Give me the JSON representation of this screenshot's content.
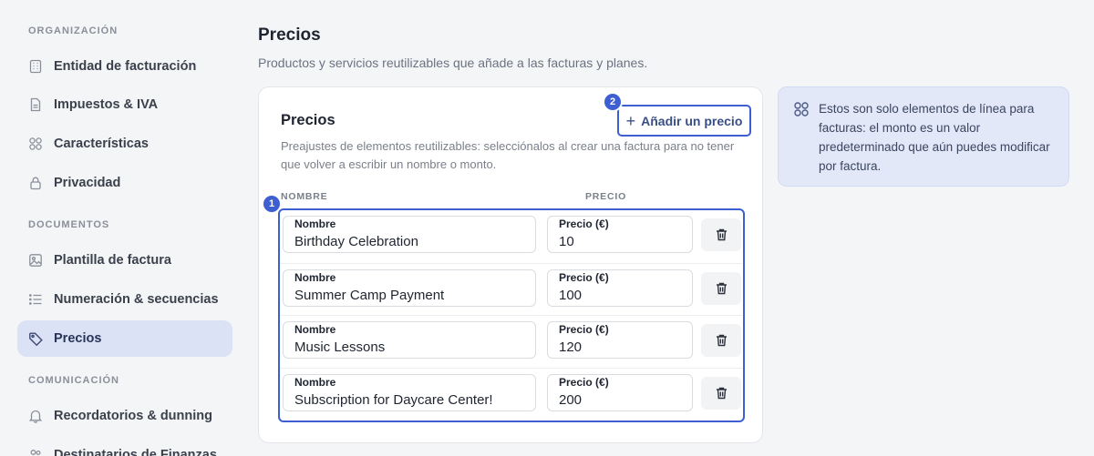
{
  "sidebar": {
    "sections": [
      {
        "label": "ORGANIZACIÓN",
        "items": [
          {
            "label": "Entidad de facturación",
            "icon": "building-icon"
          },
          {
            "label": "Impuestos & IVA",
            "icon": "document-icon"
          },
          {
            "label": "Características",
            "icon": "grid-icon"
          },
          {
            "label": "Privacidad",
            "icon": "lock-icon"
          }
        ]
      },
      {
        "label": "DOCUMENTOS",
        "items": [
          {
            "label": "Plantilla de factura",
            "icon": "image-icon"
          },
          {
            "label": "Numeración & secuencias",
            "icon": "list-icon"
          },
          {
            "label": "Precios",
            "icon": "tag-icon",
            "active": true
          }
        ]
      },
      {
        "label": "COMUNICACIÓN",
        "items": [
          {
            "label": "Recordatorios & dunning",
            "icon": "bell-icon"
          },
          {
            "label": "Destinatarios de Finanzas",
            "icon": "users-icon"
          }
        ]
      }
    ]
  },
  "main": {
    "title": "Precios",
    "subtitle": "Productos y servicios reutilizables que añade a las facturas y planes."
  },
  "card": {
    "title": "Precios",
    "description": "Preajustes de elementos reutilizables: selecciónalos al crear una factura para no tener que volver a escribir un nombre o monto.",
    "add_button": "Añadir un precio",
    "columns": {
      "name": "NOMBRE",
      "price": "PRECIO"
    },
    "badges": {
      "rows": "1",
      "add": "2"
    },
    "rows": [
      {
        "name_label": "Nombre",
        "name": "Birthday Celebration",
        "price_label": "Precio (€)",
        "price": "10"
      },
      {
        "name_label": "Nombre",
        "name": "Summer Camp Payment",
        "price_label": "Precio (€)",
        "price": "100"
      },
      {
        "name_label": "Nombre",
        "name": "Music Lessons",
        "price_label": "Precio (€)",
        "price": "120"
      },
      {
        "name_label": "Nombre",
        "name": "Subscription for Daycare Center!",
        "price_label": "Precio (€)",
        "price": "200"
      }
    ]
  },
  "info": {
    "icon": "grid-icon",
    "text": "Estos son solo elementos de línea para facturas: el monto es un valor predeterminado que aún puedes modificar por factura."
  },
  "colors": {
    "accent": "#3d5fd1",
    "active_nav_bg": "#dce2f6",
    "info_bg": "#e2e8f8",
    "page_bg": "#f4f5f7"
  }
}
